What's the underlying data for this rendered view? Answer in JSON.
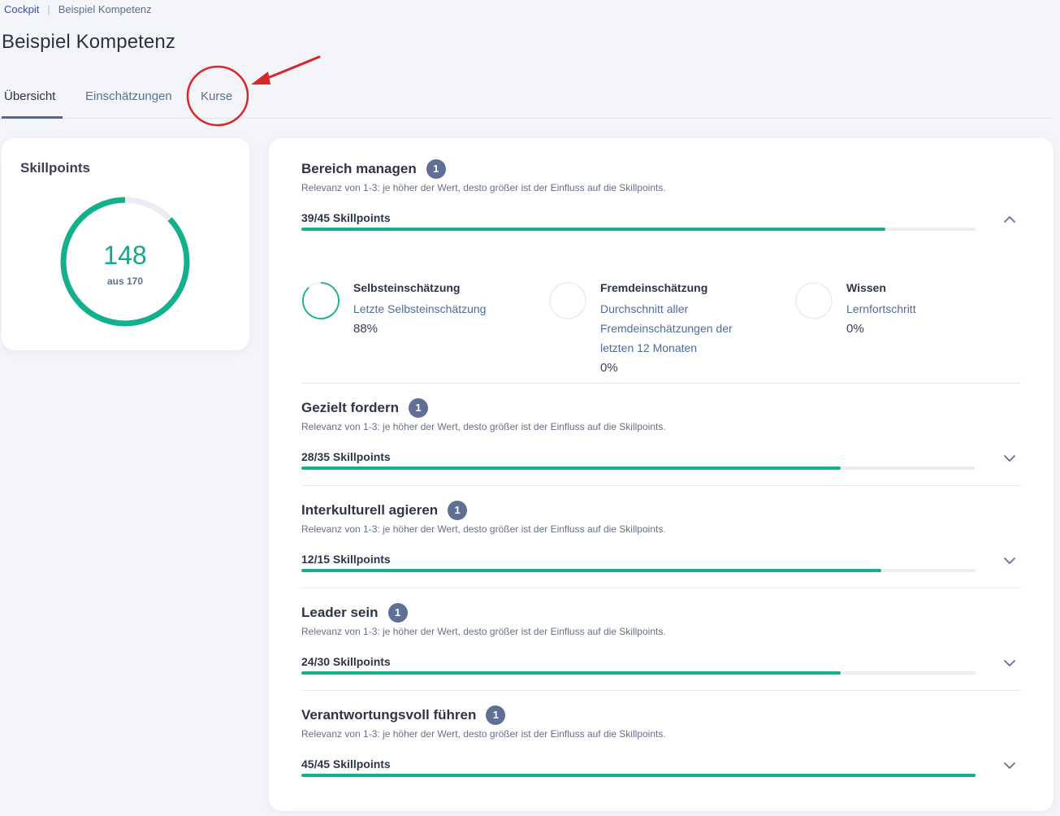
{
  "breadcrumb": {
    "home": "Cockpit",
    "separator": "|",
    "current": "Beispiel Kompetenz"
  },
  "page_title": "Beispiel Kompetenz",
  "tabs": [
    {
      "label": "Übersicht",
      "active": true
    },
    {
      "label": "Einschätzungen",
      "active": false
    },
    {
      "label": "Kurse",
      "active": false
    }
  ],
  "skillpoints": {
    "title": "Skillpoints",
    "value": "148",
    "sub": "aus 170",
    "fraction": 0.871
  },
  "colors": {
    "accent_green": "#14b08e",
    "badge": "#5f6f95",
    "link": "#4f6b9e",
    "annotation_red": "#d8262a"
  },
  "sections": [
    {
      "title": "Bereich managen",
      "relevance": "1",
      "description": "Relevanz von 1-3: je höher der Wert, desto größer ist der Einfluss auf die Skillpoints.",
      "points_label": "39/45 Skillpoints",
      "progress": 0.8667,
      "expanded": true,
      "metrics": [
        {
          "title": "Selbsteinschätzung",
          "link": "Letzte Selbsteinschätzung",
          "value": "88%",
          "progress": 0.88
        },
        {
          "title": "Fremdeinschätzung",
          "link": "Durchschnitt aller Fremdeinschätzungen der letzten 12 Monaten",
          "value": "0%",
          "progress": 0
        },
        {
          "title": "Wissen",
          "link": "Lernfortschritt",
          "value": "0%",
          "progress": 0
        }
      ]
    },
    {
      "title": "Gezielt fordern",
      "relevance": "1",
      "description": "Relevanz von 1-3: je höher der Wert, desto größer ist der Einfluss auf die Skillpoints.",
      "points_label": "28/35 Skillpoints",
      "progress": 0.8,
      "expanded": false
    },
    {
      "title": "Interkulturell agieren",
      "relevance": "1",
      "description": "Relevanz von 1-3: je höher der Wert, desto größer ist der Einfluss auf die Skillpoints.",
      "points_label": "12/15 Skillpoints",
      "progress": 0.86,
      "expanded": false
    },
    {
      "title": "Leader sein",
      "relevance": "1",
      "description": "Relevanz von 1-3: je höher der Wert, desto größer ist der Einfluss auf die Skillpoints.",
      "points_label": "24/30 Skillpoints",
      "progress": 0.8,
      "expanded": false
    },
    {
      "title": "Verantwortungsvoll führen",
      "relevance": "1",
      "description": "Relevanz von 1-3: je höher der Wert, desto größer ist der Einfluss auf die Skillpoints.",
      "points_label": "45/45 Skillpoints",
      "progress": 1.0,
      "expanded": false
    }
  ]
}
